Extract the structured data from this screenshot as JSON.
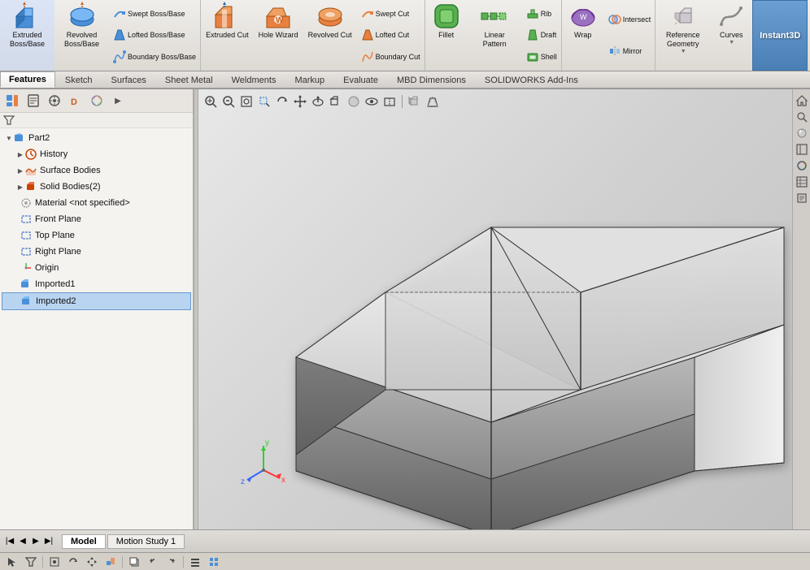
{
  "ribbon": {
    "groups": [
      {
        "id": "extruded-boss",
        "large_label": "Extruded\nBoss/Base",
        "color": "#1a5fa8",
        "has_dropdown": true
      },
      {
        "id": "revolved-boss",
        "large_label": "Revolved\nBoss/Base",
        "color": "#1a5fa8",
        "has_dropdown": true
      },
      {
        "id": "boss-group",
        "smalls": [
          {
            "id": "swept-boss",
            "label": "Swept Boss/Base"
          },
          {
            "id": "lofted-boss",
            "label": "Lofted Boss/Base"
          },
          {
            "id": "boundary-boss",
            "label": "Boundary Boss/Base"
          }
        ]
      },
      {
        "id": "extruded-cut",
        "large_label": "Extruded\nCut",
        "color": "#c86020",
        "has_dropdown": true
      },
      {
        "id": "hole-wizard",
        "large_label": "Hole\nWizard",
        "color": "#c86020"
      },
      {
        "id": "revolved-cut",
        "large_label": "Revolved\nCut",
        "color": "#c86020",
        "has_dropdown": true
      },
      {
        "id": "cut-group",
        "smalls": [
          {
            "id": "swept-cut",
            "label": "Swept Cut"
          },
          {
            "id": "lofted-cut",
            "label": "Lofted Cut"
          },
          {
            "id": "boundary-cut",
            "label": "Boundary Cut"
          }
        ]
      },
      {
        "id": "fillet",
        "large_label": "Fillet",
        "color": "#2a7a2a",
        "has_dropdown": true
      },
      {
        "id": "linear-pattern",
        "large_label": "Linear\nPattern",
        "color": "#2a7a2a",
        "has_dropdown": true
      },
      {
        "id": "feature-group",
        "smalls": [
          {
            "id": "rib",
            "label": "Rib"
          },
          {
            "id": "draft",
            "label": "Draft"
          },
          {
            "id": "shell",
            "label": "Shell"
          }
        ]
      },
      {
        "id": "wrap",
        "large_label": "Wrap",
        "color": "#7a2a8a"
      },
      {
        "id": "intersect-group",
        "smalls": [
          {
            "id": "intersect",
            "label": "Intersect"
          },
          {
            "id": "mirror",
            "label": "Mirror"
          }
        ]
      },
      {
        "id": "reference-geometry",
        "large_label": "Reference\nGeometry",
        "color": "#555",
        "has_dropdown": true
      },
      {
        "id": "curves",
        "large_label": "Curves",
        "color": "#555",
        "has_dropdown": true
      },
      {
        "id": "instant3d",
        "large_label": "Instant3D",
        "color": "#fff"
      }
    ]
  },
  "tabs": {
    "items": [
      {
        "id": "features",
        "label": "Features",
        "active": true
      },
      {
        "id": "sketch",
        "label": "Sketch",
        "active": false
      },
      {
        "id": "surfaces",
        "label": "Surfaces",
        "active": false
      },
      {
        "id": "sheet-metal",
        "label": "Sheet Metal",
        "active": false
      },
      {
        "id": "weldments",
        "label": "Weldments",
        "active": false
      },
      {
        "id": "markup",
        "label": "Markup",
        "active": false
      },
      {
        "id": "evaluate",
        "label": "Evaluate",
        "active": false
      },
      {
        "id": "mbd-dimensions",
        "label": "MBD Dimensions",
        "active": false
      },
      {
        "id": "solidworks-addins",
        "label": "SOLIDWORKS Add-Ins",
        "active": false
      }
    ]
  },
  "feature_tree": {
    "root_label": "Part2",
    "items": [
      {
        "id": "history",
        "label": "History",
        "icon": "clock",
        "color": "#cc4400",
        "indent": 1
      },
      {
        "id": "surface-bodies",
        "label": "Surface Bodies",
        "icon": "surface",
        "color": "#cc4400",
        "indent": 1
      },
      {
        "id": "solid-bodies",
        "label": "Solid Bodies(2)",
        "icon": "solid",
        "color": "#cc4400",
        "indent": 1
      },
      {
        "id": "material",
        "label": "Material <not specified>",
        "icon": "material",
        "color": "#888",
        "indent": 1
      },
      {
        "id": "front-plane",
        "label": "Front Plane",
        "icon": "plane",
        "color": "#888",
        "indent": 1
      },
      {
        "id": "top-plane",
        "label": "Top Plane",
        "icon": "plane",
        "color": "#888",
        "indent": 1
      },
      {
        "id": "right-plane",
        "label": "Right Plane",
        "icon": "plane",
        "color": "#888",
        "indent": 1
      },
      {
        "id": "origin",
        "label": "Origin",
        "icon": "origin",
        "color": "#888",
        "indent": 1
      },
      {
        "id": "imported1",
        "label": "Imported1",
        "icon": "import",
        "color": "#1a5fa8",
        "indent": 1
      },
      {
        "id": "imported2",
        "label": "Imported2",
        "icon": "import",
        "color": "#1a5fa8",
        "indent": 1,
        "selected": true
      }
    ]
  },
  "bottom_tabs": [
    {
      "id": "model",
      "label": "Model",
      "active": true
    },
    {
      "id": "motion-study",
      "label": "Motion Study 1",
      "active": false
    }
  ],
  "viewport_toolbar": {
    "tools": [
      "zoom-area",
      "zoom-in",
      "zoom-out",
      "zoom-fit",
      "rotate",
      "pan",
      "normal-to",
      "view-orient",
      "display-style",
      "hide-show",
      "section-view",
      "view-3d",
      "perspective"
    ]
  },
  "left_toolbar": {
    "buttons": [
      "select-filter",
      "feature-manager",
      "property-manager",
      "config-manager",
      "dm-manager",
      "render-tools"
    ]
  },
  "status_bar_nav": [
    "prev",
    "next",
    "start",
    "end"
  ],
  "axis_colors": {
    "x": "#ff3333",
    "y": "#33cc33",
    "z": "#3366ff"
  }
}
